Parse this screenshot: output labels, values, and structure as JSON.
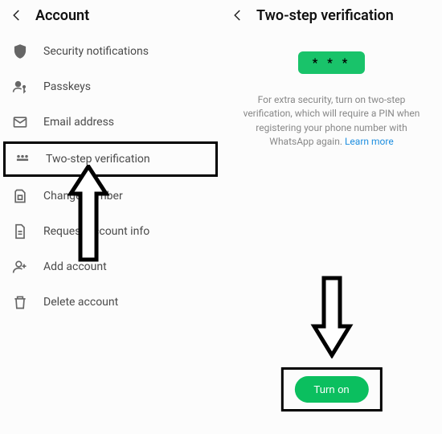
{
  "left": {
    "title": "Account",
    "items": [
      {
        "label": "Security notifications",
        "icon": "shield-icon"
      },
      {
        "label": "Passkeys",
        "icon": "passkey-icon"
      },
      {
        "label": "Email address",
        "icon": "email-icon"
      },
      {
        "label": "Two-step verification",
        "icon": "pin-icon",
        "highlight": true
      },
      {
        "label": "Change number",
        "icon": "sim-icon"
      },
      {
        "label": "Request account info",
        "icon": "doc-icon"
      },
      {
        "label": "Add account",
        "icon": "add-user-icon"
      },
      {
        "label": "Delete account",
        "icon": "delete-icon"
      }
    ]
  },
  "right": {
    "title": "Two-step verification",
    "pin_placeholder": "* * *",
    "description": "For extra security, turn on two-step verification, which will require a PIN when registering your phone number with WhatsApp again. ",
    "learn_more": "Learn more",
    "turn_on": "Turn on"
  }
}
